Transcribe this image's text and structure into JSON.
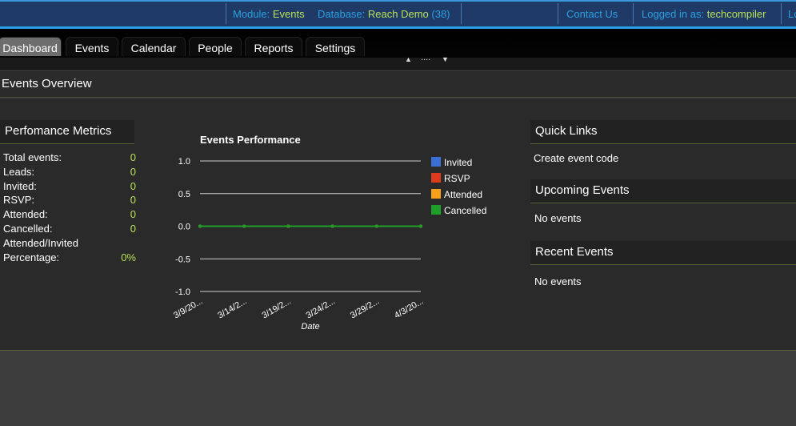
{
  "topbar": {
    "module_label": "Module:",
    "module_value": "Events",
    "database_label": "Database:",
    "database_value": "Reach Demo",
    "database_count": "(38)",
    "contact_us": "Contact Us",
    "logged_in_label": "Logged in as:",
    "logged_in_user": "techcompiler",
    "logout_partial": "Lo"
  },
  "tabs": [
    "Dashboard",
    "Events",
    "Calendar",
    "People",
    "Reports",
    "Settings"
  ],
  "active_tab": "Dashboard",
  "handle": {
    "dots": "....",
    "up": "▲",
    "down": "▼"
  },
  "page": {
    "title": "Events Overview"
  },
  "metrics": {
    "header": "Perfomance Metrics",
    "rows": [
      {
        "label": "Total events:",
        "value": "0"
      },
      {
        "label": "Leads:",
        "value": "0"
      },
      {
        "label": "Invited:",
        "value": "0"
      },
      {
        "label": "RSVP:",
        "value": "0"
      },
      {
        "label": "Attended:",
        "value": "0"
      },
      {
        "label": "Cancelled:",
        "value": "0"
      },
      {
        "label": "Attended/Invited",
        "value": ""
      },
      {
        "label": "Percentage:",
        "value": "0%"
      }
    ]
  },
  "quick_links": {
    "header": "Quick Links",
    "items": [
      "Create event code"
    ]
  },
  "upcoming": {
    "header": "Upcoming Events",
    "empty": "No events"
  },
  "recent": {
    "header": "Recent Events",
    "empty": "No events"
  },
  "colors": {
    "invited": "#3a6fd8",
    "rsvp": "#e03a1e",
    "attended": "#f5a01a",
    "cancelled": "#1f9e2a",
    "accent": "#b8e05a",
    "link": "#2aa0e0"
  },
  "chart_data": {
    "type": "line",
    "title": "Events Performance",
    "xlabel": "Date",
    "ylabel": "",
    "ylim": [
      -1.0,
      1.0
    ],
    "yticks": [
      "1.0",
      "0.5",
      "0.0",
      "-0.5",
      "-1.0"
    ],
    "categories": [
      "3/9/20...",
      "3/14/2...",
      "3/19/2...",
      "3/24/2...",
      "3/29/2...",
      "4/3/20..."
    ],
    "series": [
      {
        "name": "Invited",
        "values": [
          0,
          0,
          0,
          0,
          0,
          0
        ]
      },
      {
        "name": "RSVP",
        "values": [
          0,
          0,
          0,
          0,
          0,
          0
        ]
      },
      {
        "name": "Attended",
        "values": [
          0,
          0,
          0,
          0,
          0,
          0
        ]
      },
      {
        "name": "Cancelled",
        "values": [
          0,
          0,
          0,
          0,
          0,
          0
        ]
      }
    ],
    "legend": "right",
    "grid": true
  }
}
